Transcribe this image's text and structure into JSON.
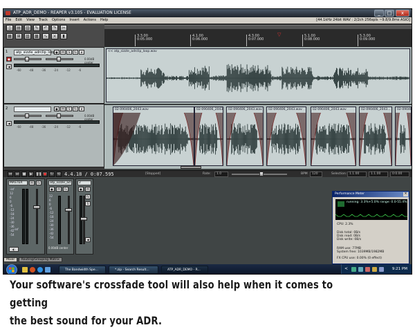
{
  "window": {
    "title": "ATP_ADR_DEMO - REAPER v3.105 - EVALUATION LICENSE",
    "minimize": "_",
    "maximize": "□",
    "close": "x"
  },
  "menu": {
    "items": [
      "File",
      "Edit",
      "View",
      "Track",
      "Options",
      "Insert",
      "Actions",
      "Help"
    ],
    "status": "[44.1kHz 24bit WAV : 2/2ch 256spls ~9.8/9.8ms ASIO]"
  },
  "ruler": {
    "marks": [
      {
        "bar": "3.3.00",
        "time": "0:05.000"
      },
      {
        "bar": "4.1.00",
        "time": "0:06.000"
      },
      {
        "bar": "4.3.00",
        "time": "0:07.000"
      },
      {
        "bar": "5.1.00",
        "time": "0:08.000"
      },
      {
        "bar": "5.3.00",
        "time": "0:09.000"
      }
    ]
  },
  "tracks": [
    {
      "num": "1",
      "name": "atp_sizzle_adrclip_loop",
      "vol": "0.00dB center",
      "meter_scale": [
        "-60",
        "-48",
        "-36",
        "-24",
        "-12",
        "-6"
      ],
      "items": [
        {
          "label": "<< atp_sizzle_adrclip_loop.wav"
        }
      ]
    },
    {
      "num": "2",
      "name": "",
      "vol": "0.00dB center",
      "meter_scale": [
        "-60",
        "-48",
        "-36",
        "-24",
        "-12",
        "-6"
      ],
      "items": [
        {
          "label": "02-090406_2043.wav"
        },
        {
          "label": "02-090406_2043..."
        },
        {
          "label": "02-090406_2043.wav"
        },
        {
          "label": "02-090406_2043.wav"
        },
        {
          "label": "02-090406_2043.wav"
        },
        {
          "label": "02-090406_2043..."
        },
        {
          "label": "02-090406_2043.wav"
        }
      ]
    }
  ],
  "transport": {
    "time": "4.4.18 / 0:07.595",
    "state": "[Stopped]",
    "rate_label": "Rate:",
    "rate": "1.0",
    "bpm_label": "BPM",
    "bpm": "120",
    "selection_label": "Selection:",
    "sel_start": "1.1.00",
    "sel_end": "1.1.00",
    "sel_len": "0:0.00"
  },
  "mixer": {
    "master_label": "MASTER",
    "strip1_label": "atp_sizzle_ad",
    "strip2_label": "2",
    "scale": [
      "-inf",
      "-inf",
      "12",
      "6",
      "0",
      "-6",
      "-12",
      "-18",
      "-24",
      "-30",
      "-36",
      "-42",
      "-54"
    ],
    "strip_vol": "0.00dB center",
    "tabs": [
      "Mixer",
      "Routing/Grouping Matrix"
    ]
  },
  "perf": {
    "title": "Performance Meter",
    "legend": "running: 3.3%+5.0%  range: 0.0-55.4%",
    "cpu": "CPU: 2.3%",
    "disk_total": "Disk total: 0B/s",
    "disk_read": "Disk read: 0B/s",
    "disk_write": "Disk write: 0B/s",
    "ram": "RAM use: 77MB",
    "sys_free": "System free: 1039MB/1982MB",
    "fx_cpu": "FX CPU use: 0.00% (0 effect)"
  },
  "taskbar": {
    "tasks": [
      "The Bandwidth Spe...",
      "*.zip - Search Result...",
      "ATP_ADR_DEMO - R..."
    ],
    "clock": "9:21 PM",
    "tray_lang": "<"
  },
  "caption": {
    "line1": "Your software's crossfade tool will also help when it comes to getting",
    "line2": "the best sound for your ADR."
  },
  "colors": {
    "waveform": "#2a3838",
    "fade": "#7a2a2a",
    "item_bg": "#c8d2d2",
    "perf_graph": "#3cc84a"
  }
}
